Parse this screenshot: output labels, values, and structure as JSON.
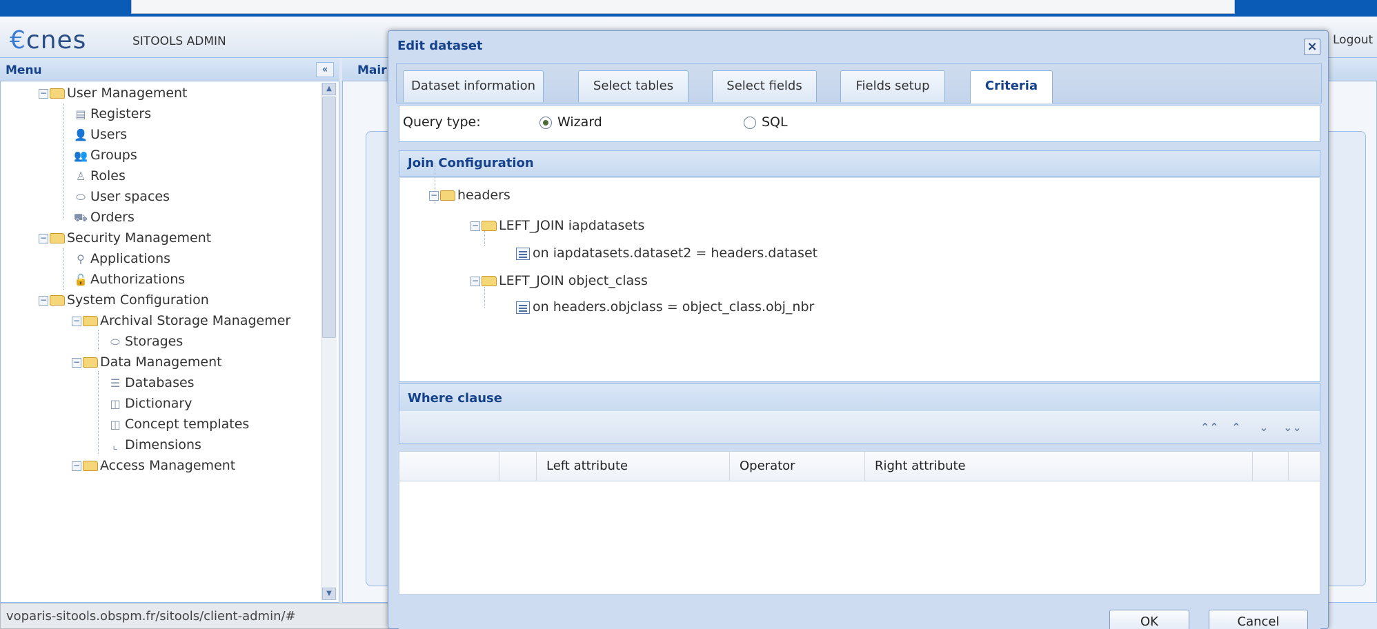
{
  "app": {
    "logo": "cnes",
    "title": "SITOOLS ADMIN",
    "logout": "Logout",
    "status_url": "voparis-sitools.obspm.fr/sitools/client-admin/#"
  },
  "menu": {
    "title": "Menu",
    "collapse": "«",
    "items": [
      {
        "label": "User Management"
      },
      {
        "label": "Registers"
      },
      {
        "label": "Users"
      },
      {
        "label": "Groups"
      },
      {
        "label": "Roles"
      },
      {
        "label": "User spaces"
      },
      {
        "label": "Orders"
      },
      {
        "label": "Security Management"
      },
      {
        "label": "Applications"
      },
      {
        "label": "Authorizations"
      },
      {
        "label": "System Configuration"
      },
      {
        "label": "Archival Storage Managemer"
      },
      {
        "label": "Storages"
      },
      {
        "label": "Data Management"
      },
      {
        "label": "Databases"
      },
      {
        "label": "Dictionary"
      },
      {
        "label": "Concept templates"
      },
      {
        "label": "Dimensions"
      },
      {
        "label": "Access Management"
      }
    ]
  },
  "main": {
    "title": "Mair"
  },
  "dialog": {
    "title": "Edit dataset",
    "close": "×",
    "tabs": [
      {
        "label": "Dataset information"
      },
      {
        "label": "Select tables"
      },
      {
        "label": "Select fields"
      },
      {
        "label": "Fields setup"
      },
      {
        "label": "Criteria"
      }
    ],
    "query_type_label": "Query type:",
    "query_options": [
      {
        "label": "Wizard",
        "selected": true
      },
      {
        "label": "SQL",
        "selected": false
      }
    ],
    "join": {
      "title": "Join Configuration",
      "root": "headers",
      "joins": [
        {
          "label": "LEFT_JOIN iapdatasets",
          "condition": "on iapdatasets.dataset2 = headers.dataset"
        },
        {
          "label": "LEFT_JOIN object_class",
          "condition": "on headers.objclass = object_class.obj_nbr"
        }
      ]
    },
    "where": {
      "title": "Where clause",
      "tools": [
        "⌃⌃",
        "⌃",
        "⌄",
        "⌄⌄"
      ],
      "columns": [
        "Left attribute",
        "Operator",
        "Right attribute"
      ]
    },
    "buttons": {
      "ok": "OK",
      "cancel": "Cancel"
    }
  },
  "colors": {
    "accent": "#15428b",
    "background": "#0a5bb5"
  }
}
